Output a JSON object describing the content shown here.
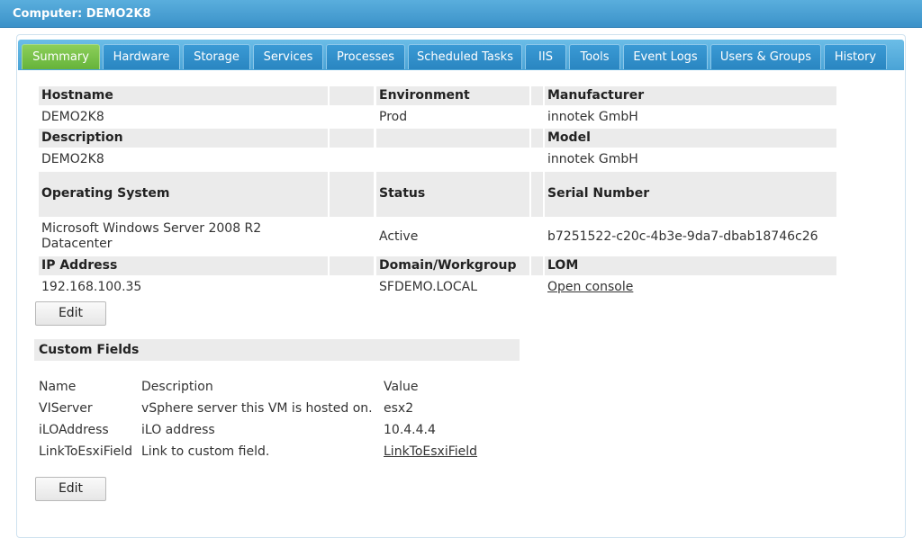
{
  "window": {
    "title": "Computer: DEMO2K8"
  },
  "tabs": [
    {
      "label": "Summary",
      "active": true
    },
    {
      "label": "Hardware"
    },
    {
      "label": "Storage"
    },
    {
      "label": "Services"
    },
    {
      "label": "Processes"
    },
    {
      "label": "Scheduled Tasks"
    },
    {
      "label": "IIS"
    },
    {
      "label": "Tools"
    },
    {
      "label": "Event Logs"
    },
    {
      "label": "Users & Groups"
    },
    {
      "label": "History"
    }
  ],
  "summary": {
    "hostname_label": "Hostname",
    "hostname": "DEMO2K8",
    "environment_label": "Environment",
    "environment": "Prod",
    "manufacturer_label": "Manufacturer",
    "manufacturer": "innotek GmbH",
    "description_label": "Description",
    "description": "DEMO2K8",
    "model_label": "Model",
    "model": "innotek GmbH",
    "os_label": "Operating System",
    "os_line1": "Microsoft Windows Server 2008 R2",
    "os_line2": "Datacenter",
    "status_label": "Status",
    "status": "Active",
    "serial_label": "Serial Number",
    "serial": "b7251522-c20c-4b3e-9da7-dbab18746c26",
    "ip_label": "IP Address",
    "ip": "192.168.100.35",
    "domain_label": "Domain/Workgroup",
    "domain": "SFDEMO.LOCAL",
    "lom_label": "LOM",
    "lom_link": "Open console",
    "edit_label": "Edit"
  },
  "custom_fields": {
    "title": "Custom Fields",
    "col_name": "Name",
    "col_description": "Description",
    "col_value": "Value",
    "rows": [
      {
        "name": "VIServer",
        "description": "vSphere server this VM is hosted on.",
        "value": "esx2"
      },
      {
        "name": "iLOAddress",
        "description": "iLO address",
        "value": "10.4.4.4"
      },
      {
        "name": "LinkToEsxiField",
        "description": "Link to custom field.",
        "value": "LinkToEsxiField"
      }
    ],
    "edit_label": "Edit"
  }
}
